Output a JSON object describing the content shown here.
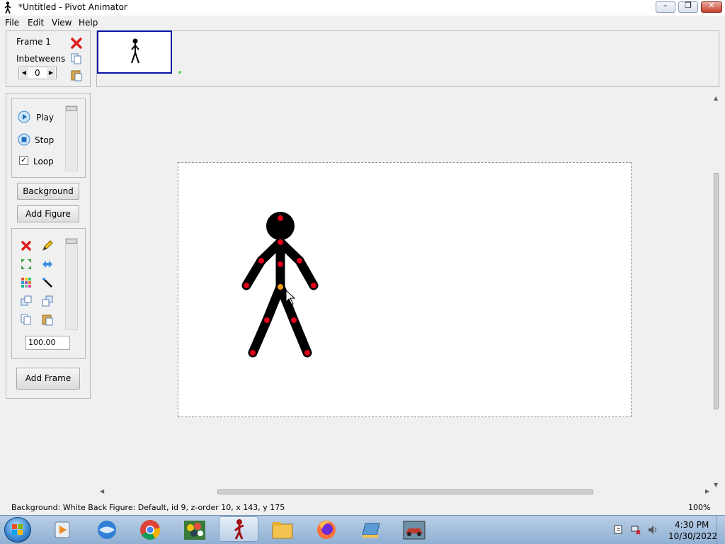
{
  "window": {
    "title": "*Untitled - Pivot Animator",
    "minimize": "–",
    "maximize": "❐",
    "close": "✕"
  },
  "menu": [
    "File",
    "Edit",
    "View",
    "Help"
  ],
  "frame_panel": {
    "frame_label": "Frame 1",
    "inbetweens_label": "Inbetweens",
    "inbetweens_value": "0"
  },
  "playback": {
    "play_label": "Play",
    "stop_label": "Stop",
    "loop_label": "Loop",
    "loop_checked": "✓"
  },
  "buttons": {
    "background": "Background",
    "add_figure": "Add Figure",
    "add_frame": "Add Frame"
  },
  "figure_tools": {
    "scale_value": "100.00"
  },
  "status": {
    "background": "Background: White Back",
    "figure": "Figure: Default,  id 9,  z-order 10,  x 143, y 175",
    "zoom": "100%"
  },
  "clock": {
    "time": "4:30 PM",
    "date": "10/30/2022"
  },
  "taskbar": [
    "start-orb",
    "media-player-icon",
    "thunderbird-icon",
    "chrome-icon",
    "pool-game-icon",
    "pivot-animator-icon",
    "file-explorer-icon",
    "firefox-icon",
    "network-folder-icon",
    "photos-car-icon"
  ],
  "colors": {
    "joint_red": "#e4001b",
    "joint_orange": "#f39c12",
    "selection_blue": "#0a14a8"
  }
}
